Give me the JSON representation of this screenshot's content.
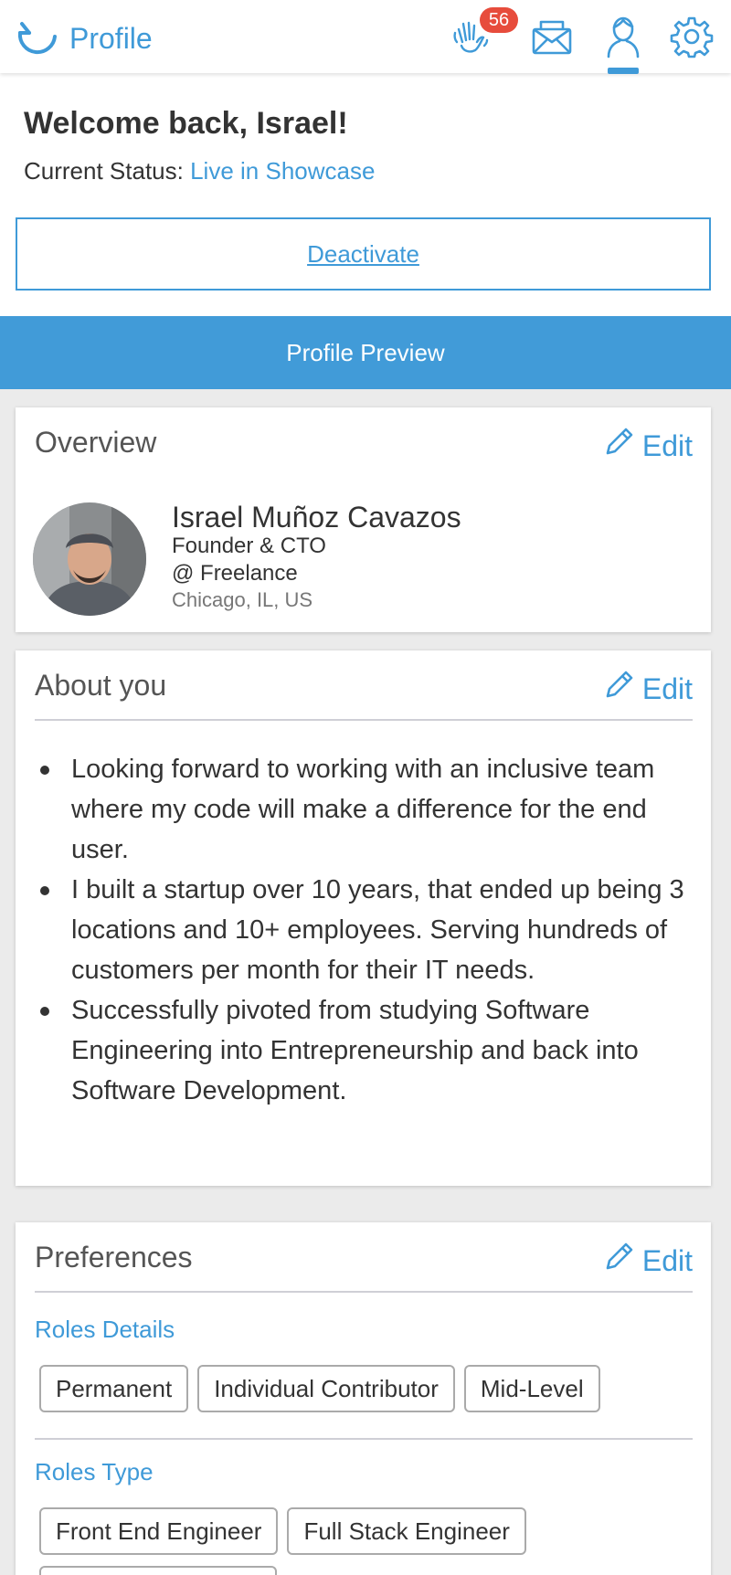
{
  "header": {
    "title": "Profile",
    "notification_count": "56",
    "icons": [
      "logo-icon",
      "wave-hand-icon",
      "mail-icon",
      "user-icon",
      "gear-icon"
    ],
    "accent_color": "#3f9ad8"
  },
  "welcome": {
    "title": "Welcome back, Israel!",
    "status_label": "Current Status:",
    "status_value": "Live in Showcase",
    "deactivate_label": "Deactivate"
  },
  "preview_bar": {
    "label": "Profile Preview"
  },
  "overview": {
    "title": "Overview",
    "edit_label": "Edit",
    "name": "Israel Muñoz Cavazos",
    "role": "Founder & CTO",
    "company": "@ Freelance",
    "location": "Chicago, IL, US"
  },
  "about": {
    "title": "About you",
    "edit_label": "Edit",
    "items": [
      "Looking forward to working with an inclusive team where my code will make a difference for the end user.",
      "I built a startup over 10 years, that ended up being 3 locations and 10+ employees. Serving hundreds of customers per month for their IT needs.",
      "Successfully pivoted from studying Software Engineering into Entrepreneurship and back into Software Development."
    ]
  },
  "preferences": {
    "title": "Preferences",
    "edit_label": "Edit",
    "roles_details_label": "Roles Details",
    "roles_details": [
      "Permanent",
      "Individual Contributor",
      "Mid-Level"
    ],
    "roles_type_label": "Roles Type",
    "roles_type": [
      "Front End Engineer",
      "Full Stack Engineer"
    ]
  }
}
